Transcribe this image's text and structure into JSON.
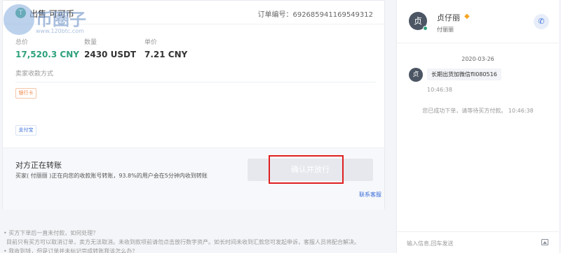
{
  "order": {
    "title": "出售 可可币",
    "order_label": "订单编号：",
    "order_number": "692685941169549312"
  },
  "stats": [
    {
      "label": "总价",
      "value": "17,520.3 CNY"
    },
    {
      "label": "数量",
      "value": "2430 USDT"
    },
    {
      "label": "单价",
      "value": "7.21 CNY"
    }
  ],
  "seller_methods_label": "卖家收款方式",
  "payments": {
    "bank": "银行卡",
    "alipay": "支付宝"
  },
  "transfer": {
    "title": "对方正在转账",
    "desc": "买家( 付丽丽 )正在向您的收款账号转账，93.8%的用户会在5分钟内收到转账",
    "confirm_button": "确认并放行",
    "contact_support": "联系客服"
  },
  "faq": [
    "• 买方下单后一直未付款，如何处理？",
    "目前只有买方可以取消订单，卖方无法取消。未收到款项前请勿点击放行数字资产。如长时间未收到汇款您可发起申诉，客服人员将配合解决。",
    "• 我收到钱，但是订单并未标记完成转账我该怎么办？"
  ],
  "chat": {
    "avatar_char": "贞",
    "name": "贞仔丽",
    "subname": "付丽丽",
    "date": "2020-03-26",
    "message": "长期出货加微信fll080516",
    "message_time": "10:46:38",
    "system_message": "您已成功下单，请等待买方付款。 10:46:38",
    "input_placeholder": "输入信息,回车发送"
  },
  "watermark": {
    "text": "币圈子",
    "url": "www.120btc.com"
  }
}
